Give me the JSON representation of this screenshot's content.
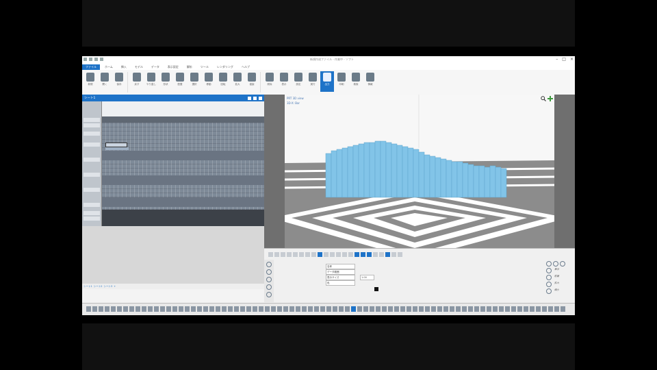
{
  "window": {
    "title": "新規作成ファイル - 作業中 - ソフト"
  },
  "ribbon": {
    "tabs": [
      "ファイル",
      "ホーム",
      "挿入",
      "モデル",
      "データ",
      "表示設定",
      "解析",
      "ツール",
      "レンダリング",
      "ヘルプ"
    ],
    "active_tab": "ファイル",
    "buttons": [
      "新規",
      "開く",
      "保存",
      "戻す",
      "やり直し",
      "形状",
      "配置",
      "選択",
      "移動",
      "回転",
      "拡大",
      "複製",
      "削除",
      "表示",
      "設定",
      "実行",
      "出力",
      "印刷",
      "検索",
      "情報"
    ],
    "active_button": "出力"
  },
  "left_panel": {
    "title": "シート1",
    "status_tabs": [
      "シート1",
      "シート2",
      "シート3",
      "+"
    ]
  },
  "viewport": {
    "label_line1": "PRT 3D view",
    "label_line2": "3D-X: Bar"
  },
  "props": {
    "fields": [
      "名称",
      "データ範囲",
      "表示サイズ",
      "1.00",
      "色"
    ],
    "right_labels": [
      "表示",
      "前面",
      "拡大",
      "縮小"
    ]
  },
  "colors": {
    "accent": "#1e73c8",
    "bars": "#82c4e8",
    "floor_dark": "#8c8c8c",
    "floor_light": "#ffffff"
  }
}
